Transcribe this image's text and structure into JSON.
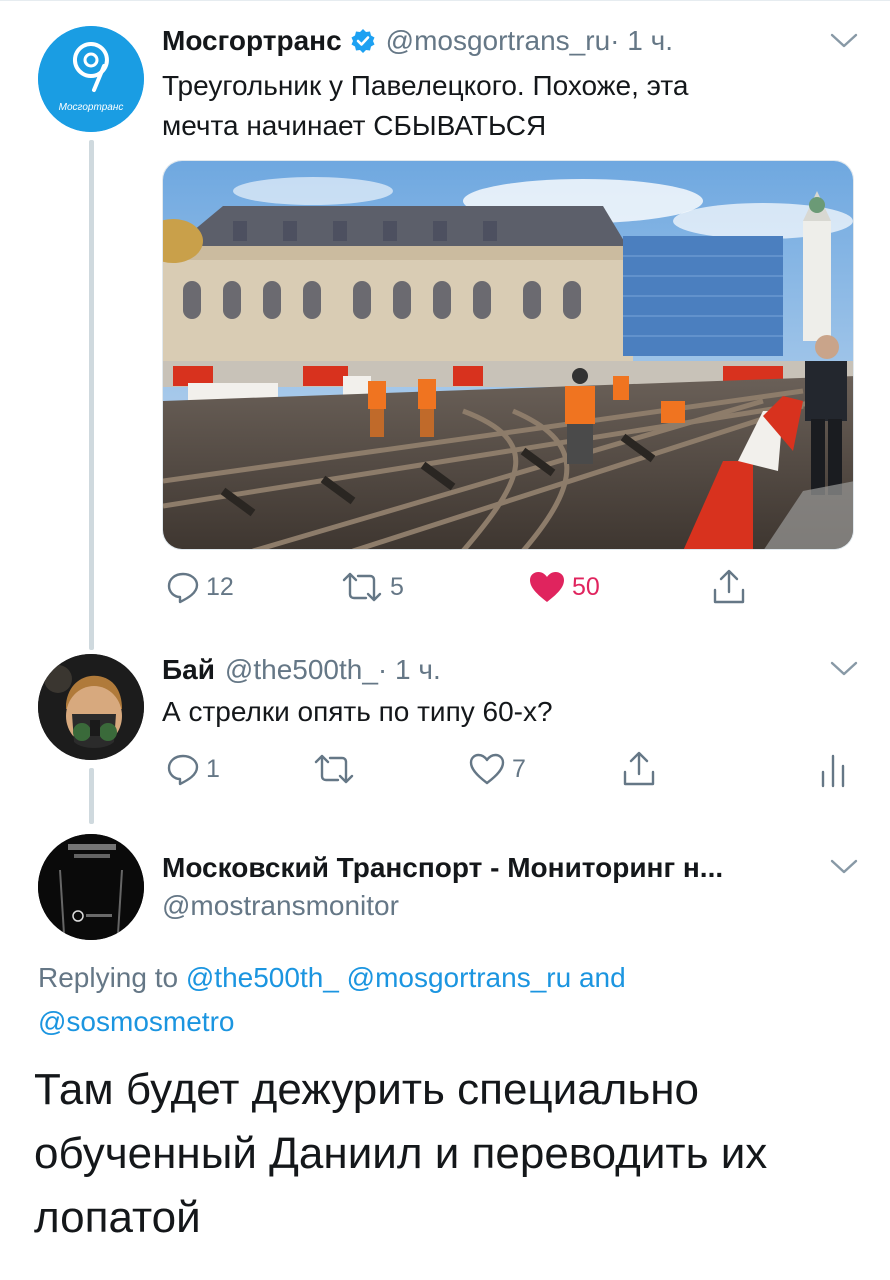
{
  "tweet1": {
    "avatar_label": "Мосгортранс",
    "name": "Мосгортранс",
    "handle": "@mosgortrans_ru",
    "time": " · 1 ч.",
    "text_line1": "Треугольник у Павелецкого. Похоже, эта",
    "text_line2": "мечта начинает СБЫВАТЬСЯ",
    "replies": "12",
    "retweets": "5",
    "likes": "50",
    "colors": {
      "brand": "#1da1f2",
      "like": "#e0245e"
    }
  },
  "tweet2": {
    "name": "Бай",
    "handle": "@the500th_",
    "time": " · 1 ч.",
    "text": "А стрелки опять по типу 60-х?",
    "replies": "1",
    "retweets": "",
    "likes": "7"
  },
  "tweet3": {
    "name": "Московский Транспорт - Мониторинг н...",
    "handle": "@mostransmonitor",
    "replying_prefix": "Replying to ",
    "replying_user1": "@the500th_",
    "replying_user2": "@mosgortrans_ru",
    "replying_and": " and",
    "replying_user3": "@sosmosmetro",
    "text": "Там будет дежурить специально обученный Даниил и переводить их лопатой"
  },
  "icons": {
    "reply": "reply-icon",
    "retweet": "retweet-icon",
    "like": "heart-icon",
    "share": "share-icon",
    "analytics": "analytics-icon",
    "more": "chevron-down-icon",
    "verified": "verified-badge-icon"
  }
}
